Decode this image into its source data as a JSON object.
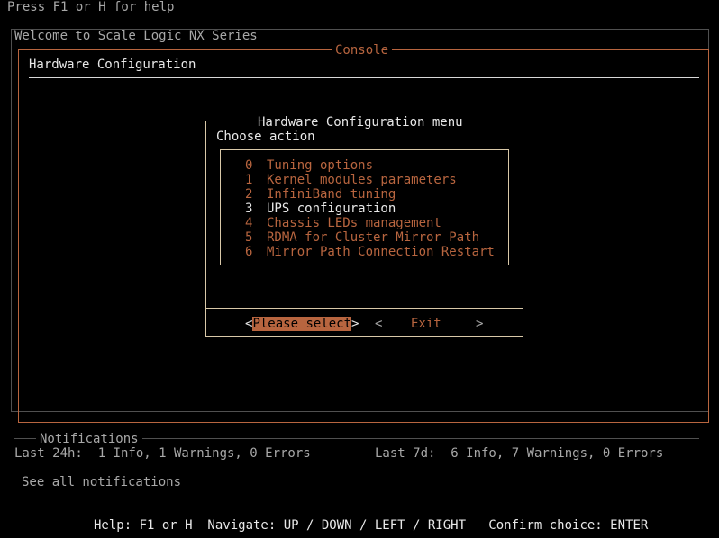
{
  "help_hint": "Press F1 or H for help",
  "welcome": "Welcome to Scale Logic NX Series",
  "console_title": "Console",
  "page_title": "Hardware Configuration",
  "dialog": {
    "title": "Hardware Configuration menu",
    "prompt": "Choose action",
    "items": [
      {
        "num": "0",
        "label": "Tuning options"
      },
      {
        "num": "1",
        "label": "Kernel modules parameters"
      },
      {
        "num": "2",
        "label": "InfiniBand tuning"
      },
      {
        "num": "3",
        "label": "UPS configuration"
      },
      {
        "num": "4",
        "label": "Chassis LEDs management"
      },
      {
        "num": "5",
        "label": "RDMA for Cluster Mirror Path"
      },
      {
        "num": "6",
        "label": "Mirror Path Connection Restart"
      }
    ],
    "selected_index": 3,
    "ok_label": "Please select",
    "exit_label": "Exit",
    "bracket_left": "<",
    "bracket_right": ">"
  },
  "notifications": {
    "title": "Notifications",
    "last24h": "Last 24h:  1 Info, 1 Warnings, 0 Errors",
    "last7d": "Last 7d:  6 Info, 7 Warnings, 0 Errors",
    "see_all": "See all notifications"
  },
  "footer": "Help: F1 or H  Navigate: UP / DOWN / LEFT / RIGHT   Confirm choice: ENTER",
  "colors": {
    "background": "#000000",
    "accent": "#b8653f",
    "text": "#a8a8a8",
    "highlight_text": "#e8e8e8"
  }
}
